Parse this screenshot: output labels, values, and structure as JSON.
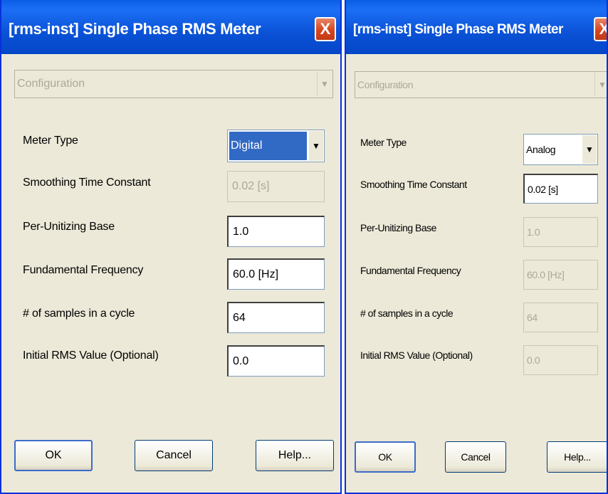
{
  "dialogs": [
    {
      "title": "[rms-inst] Single Phase RMS Meter",
      "close_label": "X",
      "section": {
        "value": "Configuration",
        "enabled": false
      },
      "fields": [
        {
          "label": "Meter Type",
          "value": "Digital",
          "kind": "dropdown",
          "enabled": true
        },
        {
          "label": "Smoothing Time Constant",
          "value": "0.02 [s]",
          "kind": "text",
          "enabled": false
        },
        {
          "label": "Per-Unitizing Base",
          "value": "1.0",
          "kind": "text",
          "enabled": true
        },
        {
          "label": "Fundamental Frequency",
          "value": "60.0 [Hz]",
          "kind": "text",
          "enabled": true
        },
        {
          "label": "# of samples in a cycle",
          "value": "64",
          "kind": "text",
          "enabled": true
        },
        {
          "label": "Initial RMS Value (Optional)",
          "value": "0.0",
          "kind": "text",
          "enabled": true
        }
      ],
      "buttons": {
        "ok": "OK",
        "cancel": "Cancel",
        "help": "Help..."
      }
    },
    {
      "title": "[rms-inst] Single Phase RMS Meter",
      "close_label": "X",
      "section": {
        "value": "Configuration",
        "enabled": false
      },
      "fields": [
        {
          "label": "Meter Type",
          "value": "Analog",
          "kind": "dropdown",
          "enabled": true
        },
        {
          "label": "Smoothing Time Constant",
          "value": "0.02 [s]",
          "kind": "text",
          "enabled": true
        },
        {
          "label": "Per-Unitizing Base",
          "value": "1.0",
          "kind": "text",
          "enabled": false
        },
        {
          "label": "Fundamental Frequency",
          "value": "60.0 [Hz]",
          "kind": "text",
          "enabled": false
        },
        {
          "label": "# of samples in a cycle",
          "value": "64",
          "kind": "text",
          "enabled": false
        },
        {
          "label": "Initial RMS Value (Optional)",
          "value": "0.0",
          "kind": "text",
          "enabled": false
        }
      ],
      "buttons": {
        "ok": "OK",
        "cancel": "Cancel",
        "help": "Help..."
      }
    }
  ],
  "icons": {
    "dropdown_arrow": "chevron-down-icon",
    "close": "close-icon"
  },
  "colors": {
    "titlebar": "#0a52d6",
    "dialog_bg": "#ece9d8",
    "selection": "#316ac5",
    "close_button": "#d6451f"
  }
}
